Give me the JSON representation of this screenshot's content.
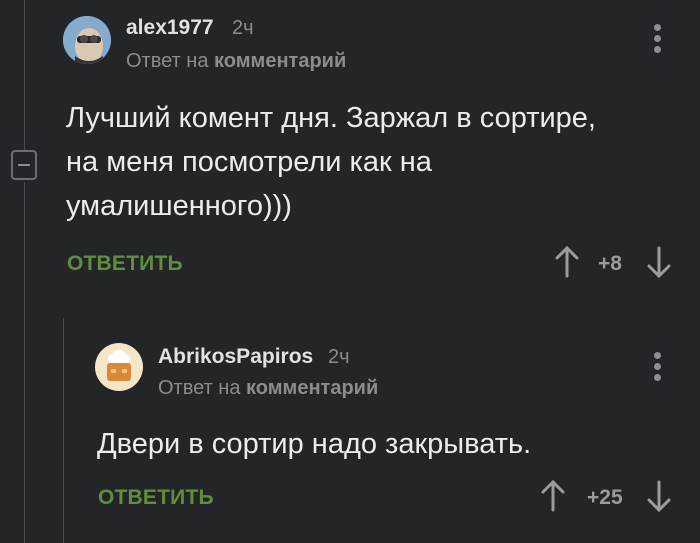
{
  "comment1": {
    "username": "alex1977",
    "time": "2ч",
    "reply_prefix": "Ответ на",
    "reply_target": "комментарий",
    "text": "Лучший комент дня. Заржал в сортире, на меня посмотрели как на умалишенного)))",
    "reply_label": "ОТВЕТИТЬ",
    "score": "+8"
  },
  "comment2": {
    "username": "AbrikosPapiros",
    "time": "2ч",
    "reply_prefix": "Ответ на",
    "reply_target": "комментарий",
    "text": "Двери в сортир надо закрывать.",
    "reply_label": "ОТВЕТИТЬ",
    "score": "+25"
  },
  "colors": {
    "background": "#242528",
    "reply_button": "#5f8f3c",
    "muted_text": "#8a8c90"
  },
  "icons": [
    "collapse-icon",
    "upvote-arrow-icon",
    "downvote-arrow-icon",
    "more-dots-icon",
    "avatar-minion-icon",
    "avatar-cake-icon"
  ]
}
